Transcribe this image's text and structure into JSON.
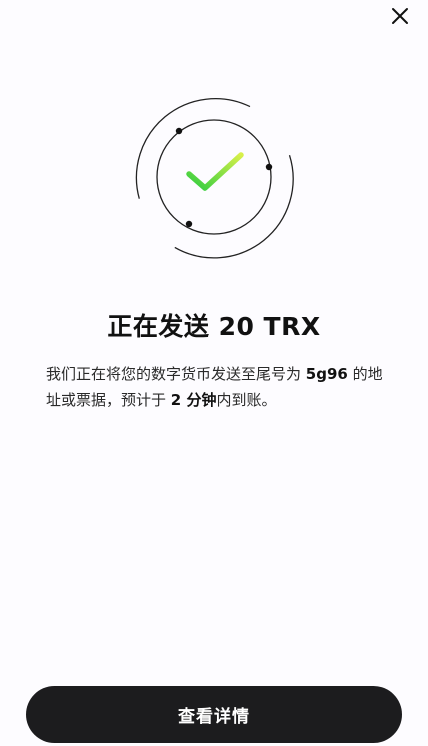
{
  "header": {
    "close_icon": "close-icon"
  },
  "status": {
    "illustration_icon": "success-checkmark-icon",
    "check_colors": [
      "#2ecc40",
      "#d8f04a"
    ],
    "title": "正在发送 20 TRX"
  },
  "message": {
    "part1": "我们正在将您的数字货币发送至尾号为 ",
    "address_suffix": "5g96",
    "part2": " 的地址或票据，预计于 ",
    "eta": "2 分钟",
    "part3": "内到账。"
  },
  "actions": {
    "details_label": "查看详情"
  },
  "colors": {
    "button_bg": "#1c1c1e",
    "button_text": "#ffffff",
    "background": "#fdfcff"
  }
}
